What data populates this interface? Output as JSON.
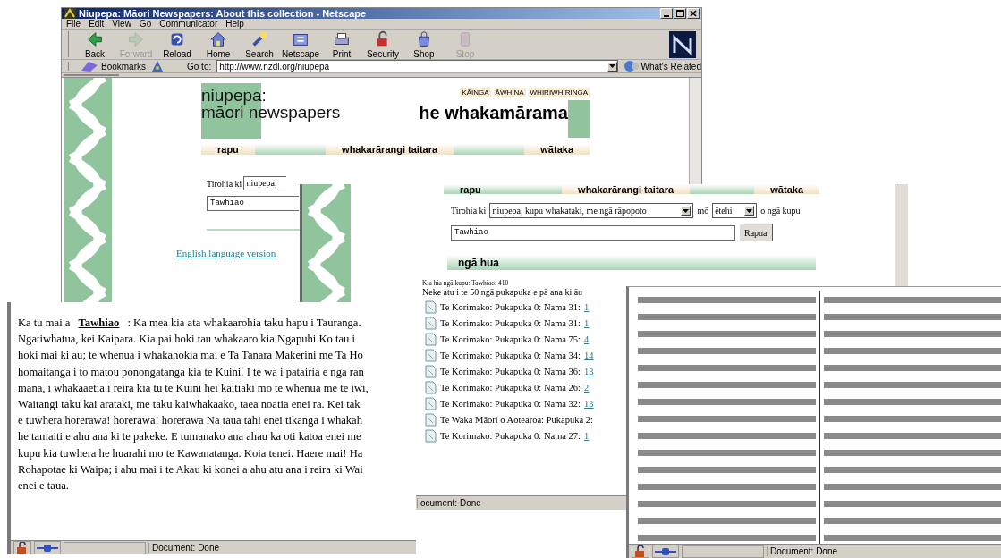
{
  "main_window": {
    "title": "Niupepa: Māori Newspapers: About this collection - Netscape",
    "menu": [
      "File",
      "Edit",
      "View",
      "Go",
      "Communicator",
      "Help"
    ],
    "toolbar": [
      {
        "label": "Back",
        "kind": "back",
        "disabled": false
      },
      {
        "label": "Forward",
        "kind": "forward",
        "disabled": true
      },
      {
        "label": "Reload",
        "kind": "reload",
        "disabled": false
      },
      {
        "label": "Home",
        "kind": "home",
        "disabled": false
      },
      {
        "label": "Search",
        "kind": "search",
        "disabled": false
      },
      {
        "label": "Netscape",
        "kind": "netscape",
        "disabled": false
      },
      {
        "label": "Print",
        "kind": "print",
        "disabled": false
      },
      {
        "label": "Security",
        "kind": "security",
        "disabled": false
      },
      {
        "label": "Shop",
        "kind": "shop",
        "disabled": false
      },
      {
        "label": "Stop",
        "kind": "stop",
        "disabled": true
      }
    ],
    "bookmarks_label": "Bookmarks",
    "goto_label": "Go to:",
    "url": "http://www.nzdl.org/niupepa",
    "related_label": "What's Related",
    "page": {
      "logo_lines": [
        "niupepa:",
        "māori newspapers"
      ],
      "top_links": [
        "KĀINGA",
        "ĀWHINA",
        "WHIRIWHIRINGA"
      ],
      "heading": "he whakamārama",
      "nav": [
        {
          "label": "rapu",
          "selected": false
        },
        {
          "label": "whakarārangi taitara",
          "selected": false
        },
        {
          "label": "wātaka",
          "selected": false
        }
      ],
      "search_label": "Tirohia ki",
      "scope_value": "niupepa,",
      "query_value": "Tawhiao",
      "english_link": "English language version"
    }
  },
  "results_window": {
    "nav": [
      {
        "label": "rapu",
        "selected": true
      },
      {
        "label": "whakarārangi taitara",
        "selected": false
      },
      {
        "label": "wātaka",
        "selected": false
      }
    ],
    "search_label": "Tirohia ki",
    "scope_value": "niupepa, kupu whakataki, me ngā rāpopoto",
    "for_label": "mō",
    "mode_value": "ētehi",
    "words_label": "o ngā kupu",
    "query_value": "Tawhiao",
    "search_button": "Rapua",
    "results_heading": "ngā hua",
    "count_line": "Kia hia ngā kupu: Tawhiao: 410",
    "summary": "Neke atu i te 50 ngā pukapuka e pā ana ki āu",
    "results": [
      {
        "title": "Te Korimako: Pukapuka 0: Nama 31:",
        "link": "1"
      },
      {
        "title": "Te Korimako: Pukapuka 0: Nama 31:",
        "link": "1"
      },
      {
        "title": "Te Korimako: Pukapuka 0: Nama 75:",
        "link": "4"
      },
      {
        "title": "Te Korimako: Pukapuka 0: Nama 34:",
        "link": "14"
      },
      {
        "title": "Te Korimako: Pukapuka 0: Nama 36:",
        "link": "13"
      },
      {
        "title": "Te Korimako: Pukapuka 0: Nama 26:",
        "link": "2"
      },
      {
        "title": "Te Korimako: Pukapuka 0: Nama 32:",
        "link": "13"
      },
      {
        "title": "Te Waka Māori o Aotearoa: Pukapuka 2:"
      },
      {
        "title": "Te Korimako: Pukapuka 0: Nama 27:",
        "link": "1"
      }
    ],
    "status": "ocument: Done"
  },
  "text_window": {
    "lines": [
      "Ka tu mai a **Tawhiao** : Ka mea kia ata whakaarohia taku hapu i Tauranga.",
      "Ngatiwhatua, kei Kaipara. Kia pai hoki tau whakaaro kia Ngapuhi Ko tau i",
      "hoki mai ki au; te whenua i whakahokia mai e Ta Tanara Makerini me Ta Ho",
      "homaitanga i to matou ponongatanga kia te Kuini. I te wa i patairia e nga ran",
      "mana, i whakaaetia i reira kia tu te Kuini hei kaitiaki mo te whenua me te iwi,",
      "Waitangi taku kai arataki, me taku kaiwhakaako, taea noatia enei ra. Kei tak",
      "e tuwhera horerawa! horerawa! horerawa Na taua tahi enei tikanga i whakah",
      "he tamaiti e ahu ana ki te pakeke. E tumanako ana ahau ka oti katoa enei me",
      "kupu kia tuwhera he huarahi mo te Kawanatanga. Koia tenei. Haere mai! Ha",
      "Rohapotae ki Waipa; i ahu mai i te Akau ki konei a ahu atu ana i reira ki Wai",
      "enei e taua."
    ],
    "status": "Document: Done"
  },
  "scan_window": {
    "status": "Document: Done"
  }
}
